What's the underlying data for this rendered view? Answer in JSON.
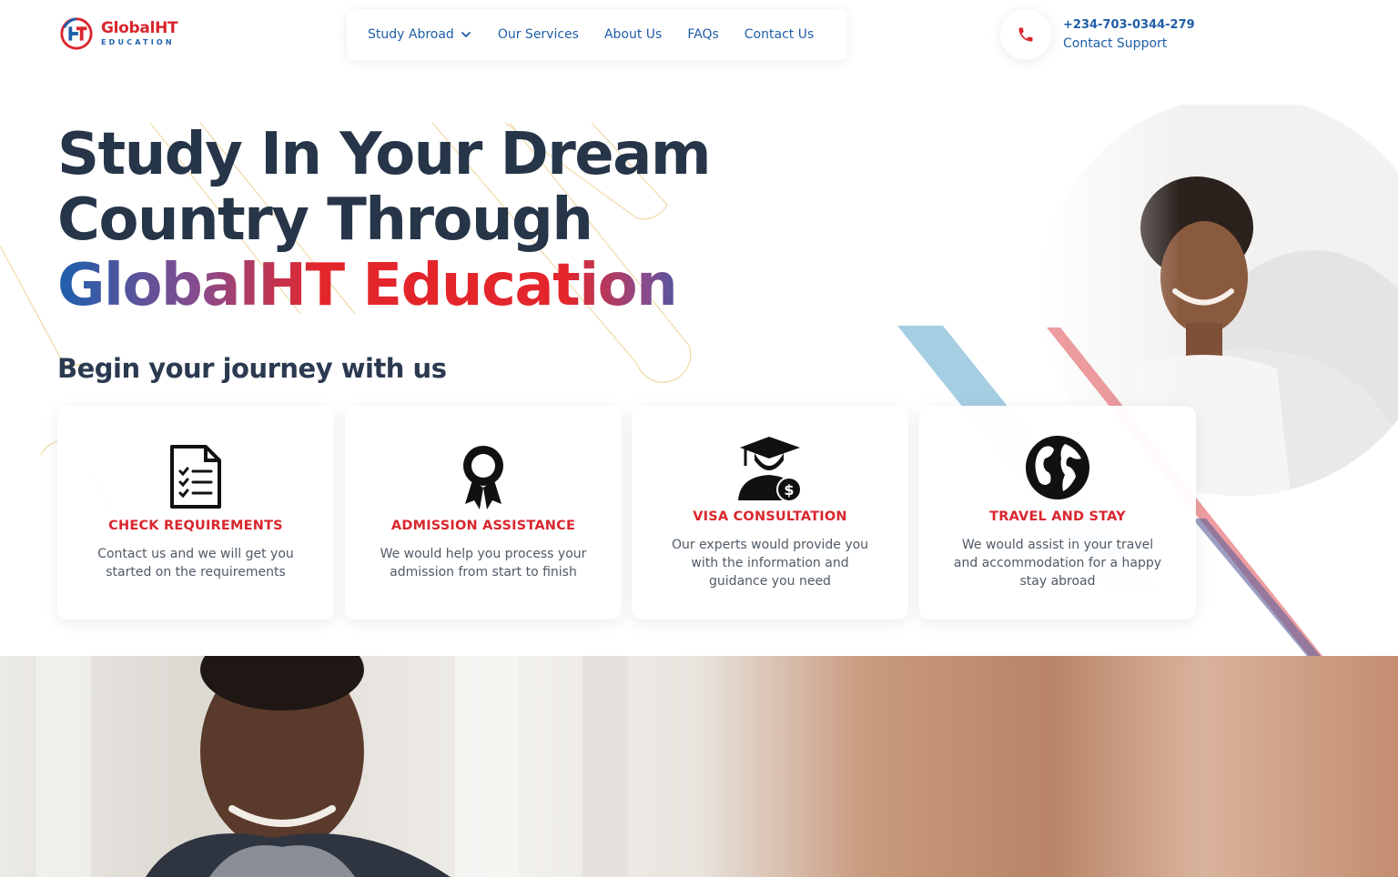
{
  "logo": {
    "name": "GlobalHT",
    "subtitle": "EDUCATION"
  },
  "nav": {
    "items": [
      {
        "label": "Study Abroad",
        "has_dropdown": true
      },
      {
        "label": "Our Services"
      },
      {
        "label": "About Us"
      },
      {
        "label": "FAQs"
      },
      {
        "label": "Contact Us"
      }
    ]
  },
  "contact": {
    "phone": "+234-703-0344-279",
    "label": "Contact Support",
    "icon": "phone-icon"
  },
  "hero": {
    "title_line1": "Study In Your Dream",
    "title_line2": "Country Through",
    "title_line3": "GlobalHT Education",
    "subtitle": "Begin your journey with us"
  },
  "cards": [
    {
      "icon": "checklist-document-icon",
      "title": "CHECK REQUIREMENTS",
      "description": "Contact us and we will get you started on the requirements"
    },
    {
      "icon": "award-ribbon-icon",
      "title": "ADMISSION ASSISTANCE",
      "description": "We would help you process your admission from start to finish"
    },
    {
      "icon": "graduate-dollar-icon",
      "title": "VISA CONSULTATION",
      "description": "Our experts would provide you with the information and guidance you need"
    },
    {
      "icon": "globe-icon",
      "title": "TRAVEL AND STAY",
      "description": "We would assist in your travel and accommodation for a happy stay abroad"
    }
  ],
  "colors": {
    "brand_red": "#d9262d",
    "brand_blue": "#1f5ea8",
    "heading": "#263548"
  }
}
